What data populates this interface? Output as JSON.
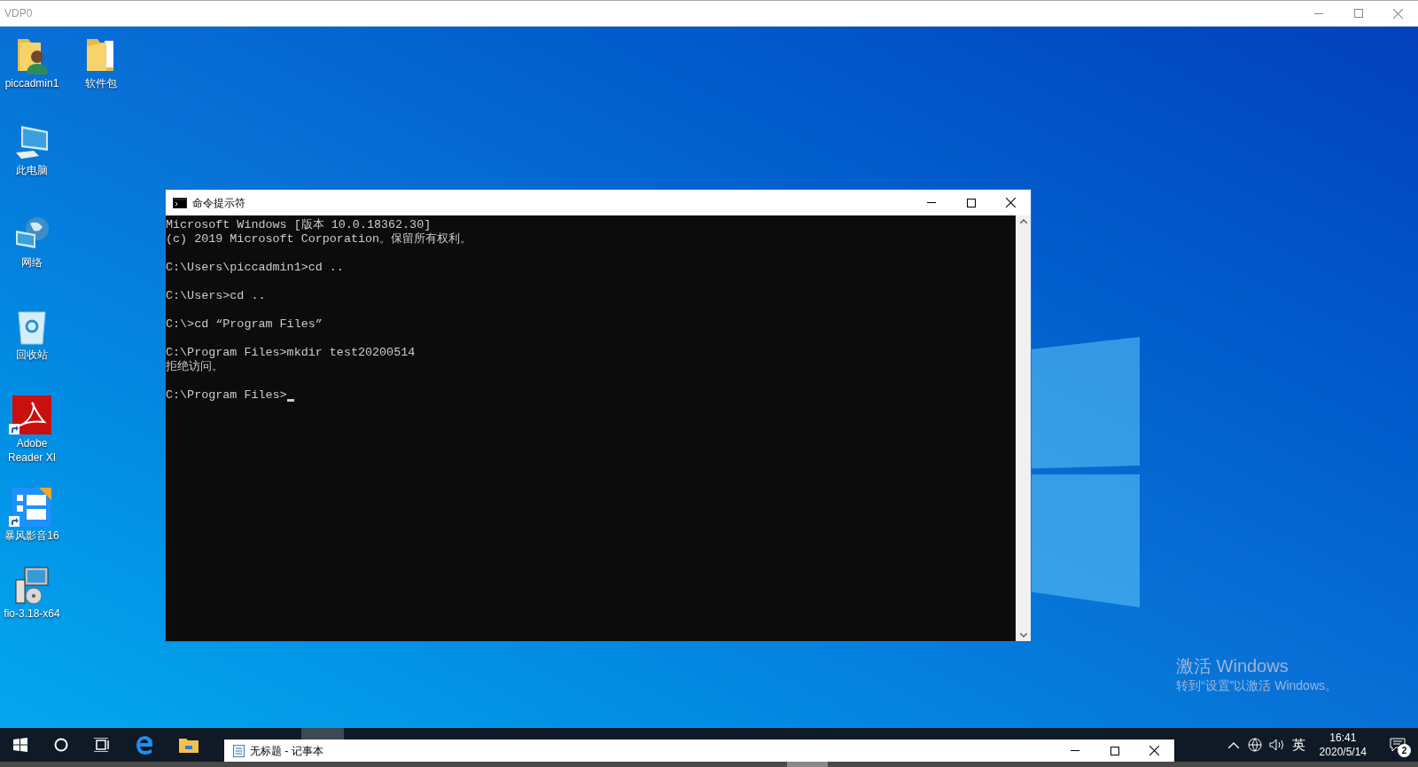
{
  "window": {
    "title": "VDP0"
  },
  "desktop_icons": [
    {
      "label": "piccadmin1",
      "kind": "user-folder"
    },
    {
      "label": "软件包",
      "kind": "folder"
    },
    {
      "label": "此电脑",
      "kind": "computer"
    },
    {
      "label": "网络",
      "kind": "network"
    },
    {
      "label": "回收站",
      "kind": "recycle-bin"
    },
    {
      "label": "Adobe Reader XI",
      "kind": "pdf",
      "shortcut": true
    },
    {
      "label": "暴风影音16",
      "kind": "player",
      "shortcut": true
    },
    {
      "label": "fio-3.18-x64",
      "kind": "installer",
      "shortcut": false
    }
  ],
  "cmd_window": {
    "title": "命令提示符",
    "cursor_visible": true,
    "blocks": [
      [
        "Microsoft Windows [版本 10.0.18362.30]",
        "(c) 2019 Microsoft Corporation。保留所有权利。"
      ],
      [
        "C:\\Users\\piccadmin1>cd .."
      ],
      [
        "C:\\Users>cd .."
      ],
      [
        "C:\\>cd “Program Files”"
      ],
      [
        "C:\\Program Files>mkdir test20200514",
        "拒绝访问。"
      ],
      [
        "C:\\Program Files>"
      ]
    ]
  },
  "activation": {
    "title": "激活 Windows",
    "text": "转到“设置”以激活 Windows。"
  },
  "notepad_window": {
    "title": "无标题 - 记事本"
  },
  "tray": {
    "input_language": "英",
    "time": "16:41",
    "date": "2020/5/14",
    "notification_count": "2"
  }
}
